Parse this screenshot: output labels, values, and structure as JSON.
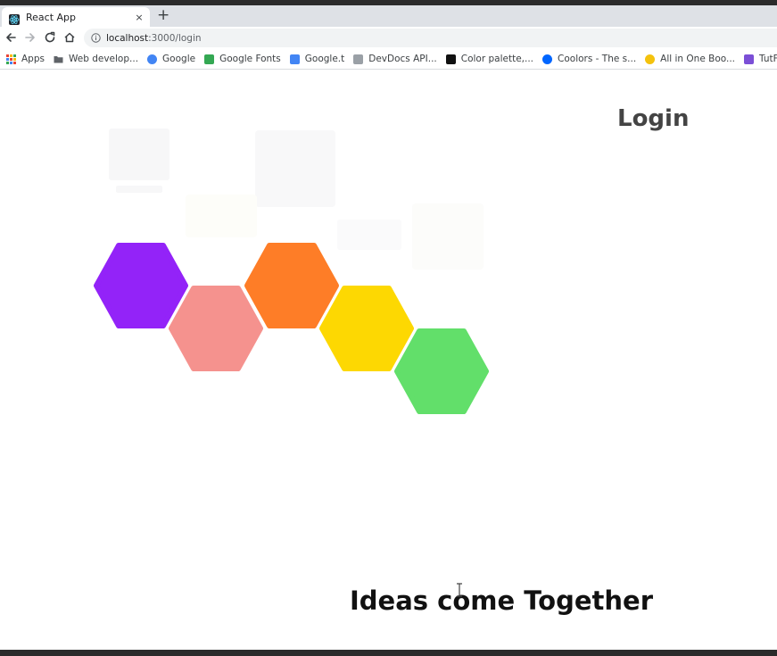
{
  "browser": {
    "tab": {
      "title": "React App",
      "close_label": "×"
    },
    "new_tab_label": "+",
    "url_host": "localhost",
    "url_path": ":3000/login",
    "bookmarks": [
      {
        "label": "Apps",
        "icon": "apps-grid-icon",
        "color": "#ea4335"
      },
      {
        "label": "Web develop...",
        "icon": "folder-icon",
        "color": "#5f6368"
      },
      {
        "label": "Google",
        "icon": "google-icon",
        "color": "#4285f4"
      },
      {
        "label": "Google Fonts",
        "icon": "google-fonts-icon",
        "color": "#34a853"
      },
      {
        "label": "Google.t",
        "icon": "google-translate-icon",
        "color": "#4285f4"
      },
      {
        "label": "DevDocs API...",
        "icon": "devdocs-icon",
        "color": "#9aa0a6"
      },
      {
        "label": "Color palette,...",
        "icon": "color-palette-icon",
        "color": "#111111"
      },
      {
        "label": "Coolors - The s...",
        "icon": "coolors-icon",
        "color": "#0066ff"
      },
      {
        "label": "All in One Boo...",
        "icon": "all-in-one-icon",
        "color": "#f4c20d"
      },
      {
        "label": "TutFlix - Free",
        "icon": "tutflix-icon",
        "color": "#7b4fd6"
      }
    ]
  },
  "page": {
    "login_title": "Login",
    "tagline": "Ideas come Together",
    "hexagon_colors": [
      "#9323f8",
      "#f5928e",
      "#fe7d27",
      "#fdd802",
      "#62df6a"
    ]
  }
}
